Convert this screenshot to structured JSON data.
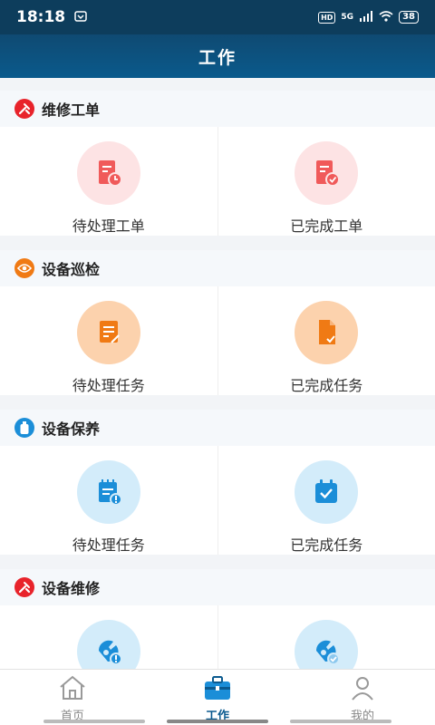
{
  "status": {
    "time": "18:18",
    "network": "5G",
    "hd": "HD",
    "battery": "38"
  },
  "header": {
    "title": "工作"
  },
  "sections": [
    {
      "title": "维修工单",
      "items": [
        {
          "label": "待处理工单"
        },
        {
          "label": "已完成工单"
        }
      ]
    },
    {
      "title": "设备巡检",
      "items": [
        {
          "label": "待处理任务"
        },
        {
          "label": "已完成任务"
        }
      ]
    },
    {
      "title": "设备保养",
      "items": [
        {
          "label": "待处理任务"
        },
        {
          "label": "已完成任务"
        }
      ]
    },
    {
      "title": "设备维修",
      "items": [
        {
          "label": ""
        },
        {
          "label": ""
        }
      ]
    }
  ],
  "tabs": [
    {
      "label": "首页"
    },
    {
      "label": "工作",
      "active": true
    },
    {
      "label": "我的"
    }
  ],
  "colors": {
    "primary": "#0b5a8f",
    "red": "#f05a5a",
    "orange": "#f07a14",
    "blue": "#1b8ed8"
  }
}
